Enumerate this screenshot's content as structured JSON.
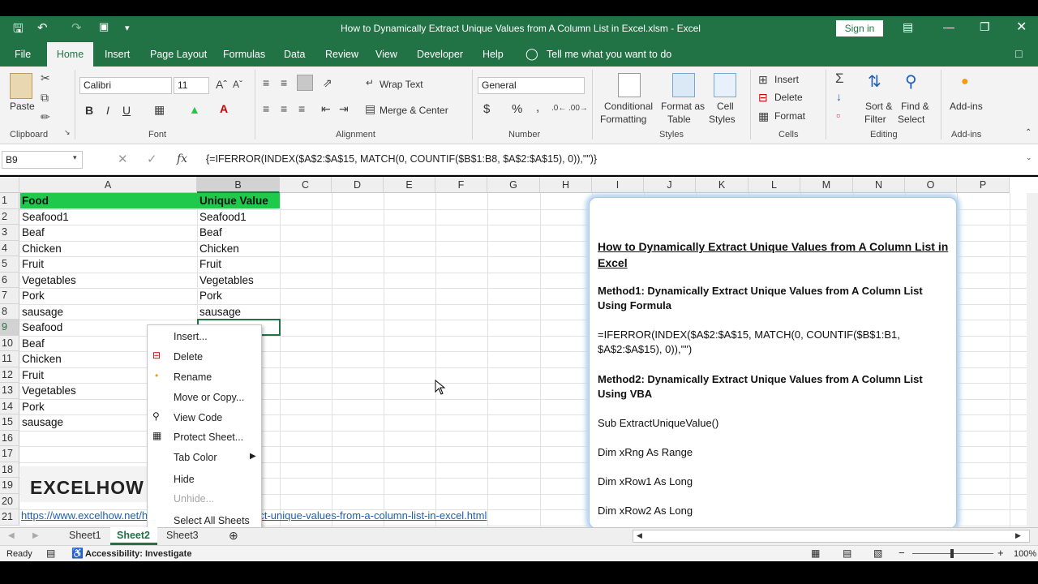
{
  "window": {
    "title": "How to Dynamically Extract Unique Values from A Column List in Excel.xlsm  -  Excel",
    "sign_in": "Sign in"
  },
  "tabs": [
    "File",
    "Home",
    "Insert",
    "Page Layout",
    "Formulas",
    "Data",
    "Review",
    "View",
    "Developer",
    "Help"
  ],
  "tell_me": "Tell me what you want to do",
  "ribbon": {
    "clipboard": {
      "label": "Clipboard",
      "paste": "Paste"
    },
    "font": {
      "label": "Font",
      "name": "Calibri",
      "size": "11",
      "bold": "B",
      "italic": "I",
      "underline": "U"
    },
    "alignment": {
      "label": "Alignment",
      "wrap": "Wrap Text",
      "merge": "Merge & Center"
    },
    "number": {
      "label": "Number",
      "format": "General",
      "currency": "$",
      "percent": "%",
      "comma": ","
    },
    "styles": {
      "label": "Styles",
      "conditional_1": "Conditional",
      "conditional_2": "Formatting",
      "format_table_1": "Format as",
      "format_table_2": "Table",
      "cell_styles_1": "Cell",
      "cell_styles_2": "Styles"
    },
    "cells": {
      "label": "Cells",
      "insert": "Insert",
      "delete": "Delete",
      "format": "Format"
    },
    "editing": {
      "label": "Editing",
      "sort_1": "Sort &",
      "sort_2": "Filter",
      "find_1": "Find &",
      "find_2": "Select"
    },
    "addins": {
      "label": "Add-ins",
      "name": "Add-ins"
    }
  },
  "formula_bar": {
    "name_box": "B9",
    "fx": "fx",
    "formula": "{=IFERROR(INDEX($A$2:$A$15, MATCH(0, COUNTIF($B$1:B8, $A$2:$A$15), 0)),\"\")}"
  },
  "columns": [
    "A",
    "B",
    "C",
    "D",
    "E",
    "F",
    "G",
    "H",
    "I",
    "J",
    "K",
    "L",
    "M",
    "N",
    "O",
    "P"
  ],
  "rows": [
    "1",
    "2",
    "3",
    "4",
    "5",
    "6",
    "7",
    "8",
    "9",
    "10",
    "11",
    "12",
    "13",
    "14",
    "15",
    "16",
    "17",
    "18",
    "19",
    "20",
    "21"
  ],
  "headers": {
    "a1": "Food",
    "b1": "Unique Value"
  },
  "colA": [
    "Seafood1",
    "Beaf",
    "Chicken",
    "Fruit",
    "Vegetables",
    "Pork",
    "sausage",
    "Seafood",
    "Beaf",
    "Chicken",
    "Fruit",
    "Vegetables",
    "Pork",
    "sausage"
  ],
  "colB": [
    "Seafood1",
    "Beaf",
    "Chicken",
    "Fruit",
    "Vegetables",
    "Pork",
    "sausage"
  ],
  "watermark": "EXCELHOW",
  "link": "https://www.excelhow.net/how-to-dynamically-extract-unique-values-from-a-column-list-in-excel.html",
  "textbox": {
    "title": "How to Dynamically Extract Unique Values from A Column List in Excel",
    "m1": "Method1: Dynamically Extract Unique Values from A Column List Using Formula",
    "f1": "=IFERROR(INDEX($A$2:$A$15, MATCH(0, COUNTIF($B$1:B1, $A$2:$A$15), 0)),\"\")",
    "m2": "Method2: Dynamically Extract Unique Values from A Column List Using VBA",
    "c1": "Sub ExtractUniqueValue()",
    "c2": "Dim xRng As Range",
    "c3": "Dim xRow1 As Long",
    "c4": "Dim xRow2 As Long"
  },
  "context_menu": [
    "Insert...",
    "Delete",
    "Rename",
    "Move or Copy...",
    "View Code",
    "Protect Sheet...",
    "Tab Color",
    "Hide",
    "Unhide...",
    "Select All Sheets"
  ],
  "sheets": [
    "Sheet1",
    "Sheet2",
    "Sheet3"
  ],
  "status": {
    "ready": "Ready",
    "accessibility": "Accessibility: Investigate",
    "zoom": "100%"
  },
  "colors": {
    "excel_green": "#217346",
    "header_fill": "#1ec94b",
    "link": "#1f5fb4"
  }
}
